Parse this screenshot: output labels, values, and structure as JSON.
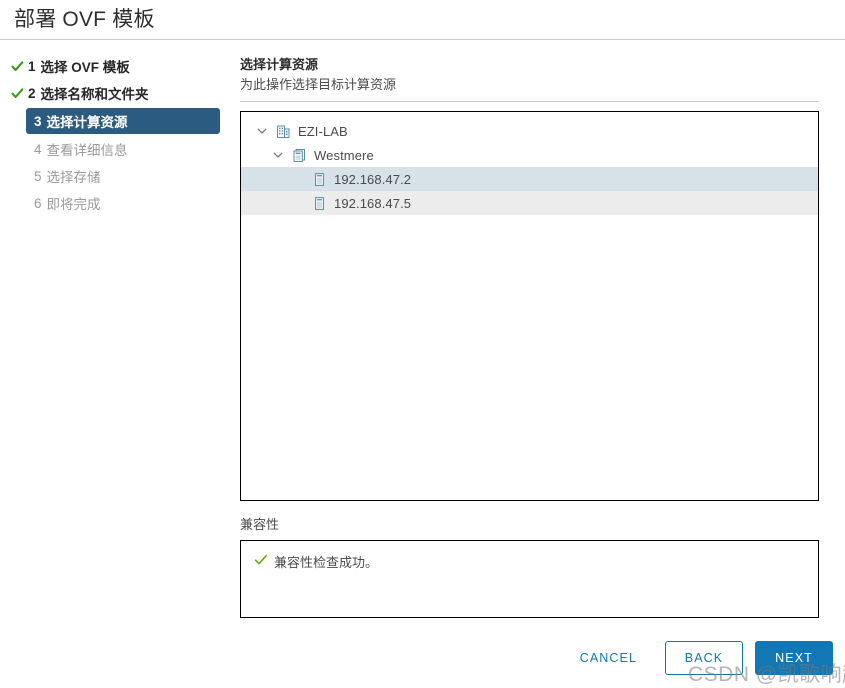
{
  "window": {
    "title": "部署 OVF 模板"
  },
  "steps": [
    {
      "num": "1",
      "label": "选择 OVF 模板",
      "state": "done",
      "icon": "check-icon"
    },
    {
      "num": "2",
      "label": "选择名称和文件夹",
      "state": "done",
      "icon": "check-icon"
    },
    {
      "num": "3",
      "label": "选择计算资源",
      "state": "active",
      "icon": "none"
    },
    {
      "num": "4",
      "label": "查看详细信息",
      "state": "pending",
      "icon": "none"
    },
    {
      "num": "5",
      "label": "选择存储",
      "state": "pending",
      "icon": "none"
    },
    {
      "num": "6",
      "label": "即将完成",
      "state": "pending",
      "icon": "none"
    }
  ],
  "content": {
    "title": "选择计算资源",
    "subtitle": "为此操作选择目标计算资源"
  },
  "tree": {
    "nodes": [
      {
        "label": "EZI-LAB",
        "level": 0,
        "icon": "datacenter-icon",
        "expanded": true,
        "twisty": "chevron-down-icon",
        "row": "plain"
      },
      {
        "label": "Westmere",
        "level": 1,
        "icon": "cluster-icon",
        "expanded": true,
        "twisty": "chevron-down-icon",
        "row": "plain"
      },
      {
        "label": "192.168.47.2",
        "level": 2,
        "icon": "host-icon",
        "expanded": false,
        "twisty": "none",
        "row": "selected"
      },
      {
        "label": "192.168.47.5",
        "level": 2,
        "icon": "host-icon",
        "expanded": false,
        "twisty": "none",
        "row": "alt"
      }
    ]
  },
  "compatibility": {
    "label": "兼容性",
    "message": "兼容性检查成功。",
    "icon": "check-icon"
  },
  "footer": {
    "cancel_label": "CANCEL",
    "back_label": "BACK",
    "next_label": "NEXT"
  },
  "watermark": {
    "text": "CSDN @凯歌响起"
  },
  "colors": {
    "accent": "#1177b5",
    "link": "#0f77b6",
    "active_step_bg": "#2b5b80",
    "success": "#5aa700",
    "selected_row_bg": "#d7e2e8",
    "alt_row_bg": "#ececec",
    "icon_blue": "#5b8da8"
  }
}
